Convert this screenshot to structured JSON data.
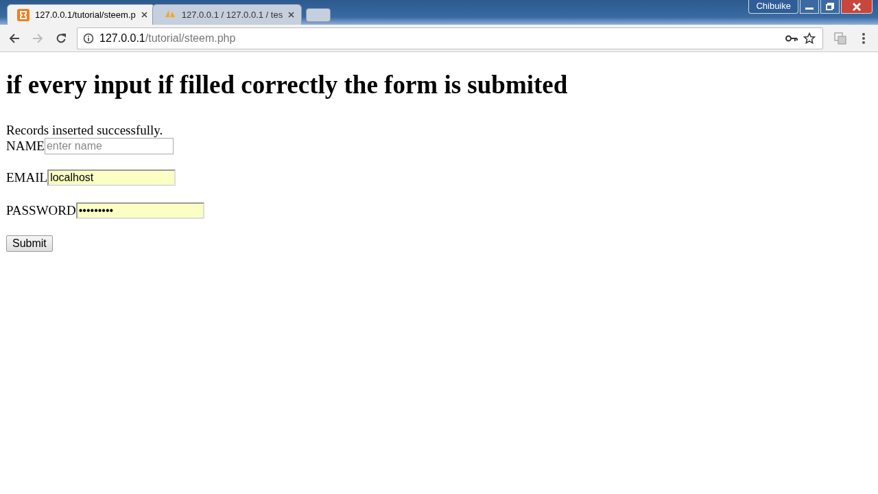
{
  "window": {
    "user": "Chibuike"
  },
  "tabs": [
    {
      "label": "127.0.0.1/tutorial/steem.p",
      "kind": "xampp",
      "selected": true
    },
    {
      "label": "127.0.0.1 / 127.0.0.1 / tes",
      "kind": "pma",
      "selected": false
    }
  ],
  "address_bar": {
    "host": "127.0.0.1",
    "path": "/tutorial/steem.php"
  },
  "page": {
    "heading": "if every input if filled correctly the form is submited",
    "message": "Records inserted successfully.",
    "fields": [
      {
        "label": "NAME",
        "placeholder": "enter name",
        "autofilled": false
      },
      {
        "label": "EMAIL",
        "value": "localhost",
        "autofilled": true
      },
      {
        "label": "PASSWORD",
        "value": "•••••••••",
        "autofilled": true
      }
    ],
    "submit": "Submit"
  }
}
